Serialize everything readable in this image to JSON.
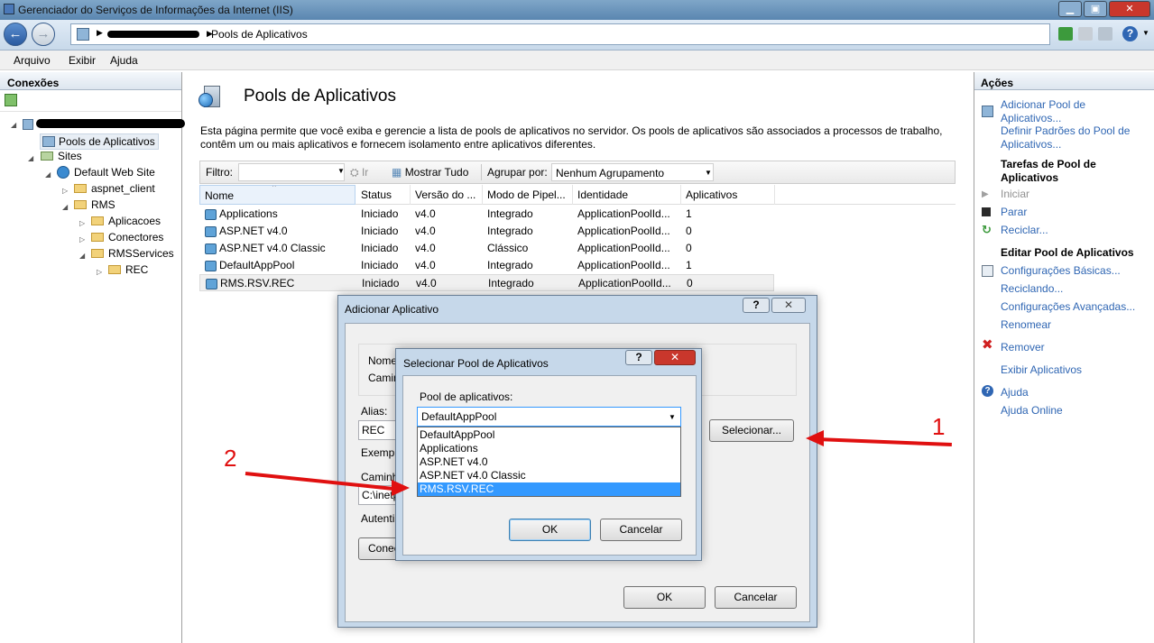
{
  "window": {
    "title": "Gerenciador do Serviços de Informações da Internet (IIS)"
  },
  "address": {
    "current": "Pools de Aplicativos"
  },
  "menu": {
    "file": "Arquivo",
    "view": "Exibir",
    "help": "Ajuda"
  },
  "connections": {
    "header": "Conexões",
    "items": [
      "Pools de Aplicativos",
      "Sites",
      "Default Web Site",
      "aspnet_client",
      "RMS",
      "Aplicacoes",
      "Conectores",
      "RMSServices",
      "REC"
    ]
  },
  "main": {
    "title": "Pools de Aplicativos",
    "description": "Esta página permite que você exiba e gerencie a lista de pools de aplicativos no servidor. Os pools de aplicativos são associados a processos de trabalho, contêm um ou mais aplicativos e fornecem isolamento entre aplicativos diferentes.",
    "filter_label": "Filtro:",
    "go_label": "Ir",
    "show_all": "Mostrar Tudo",
    "group_by_label": "Agrupar por:",
    "group_by_value": "Nenhum Agrupamento",
    "columns": [
      "Nome",
      "Status",
      "Versão do ...",
      "Modo de Pipel...",
      "Identidade",
      "Aplicativos"
    ],
    "rows": [
      [
        "Applications",
        "Iniciado",
        "v4.0",
        "Integrado",
        "ApplicationPoolId...",
        "1"
      ],
      [
        "ASP.NET v4.0",
        "Iniciado",
        "v4.0",
        "Integrado",
        "ApplicationPoolId...",
        "0"
      ],
      [
        "ASP.NET v4.0 Classic",
        "Iniciado",
        "v4.0",
        "Clássico",
        "ApplicationPoolId...",
        "0"
      ],
      [
        "DefaultAppPool",
        "Iniciado",
        "v4.0",
        "Integrado",
        "ApplicationPoolId...",
        "1"
      ],
      [
        "RMS.RSV.REC",
        "Iniciado",
        "v4.0",
        "Integrado",
        "ApplicationPoolId...",
        "0"
      ]
    ]
  },
  "actions": {
    "header": "Ações",
    "add_pool": "Adicionar Pool de Aplicativos...",
    "set_defaults": "Definir Padrões do Pool de Aplicativos...",
    "tasks_header": "Tarefas de Pool de Aplicativos",
    "start": "Iniciar",
    "stop": "Parar",
    "recycle": "Reciclar...",
    "edit_header": "Editar Pool de Aplicativos",
    "basic": "Configurações Básicas...",
    "recycling": "Reciclando...",
    "advanced": "Configurações Avançadas...",
    "rename": "Renomear",
    "remove": "Remover",
    "view_apps": "Exibir Aplicativos",
    "help": "Ajuda",
    "help_online": "Ajuda Online"
  },
  "add_app_dialog": {
    "title": "Adicionar Aplicativo",
    "site_label": "Nome",
    "path_label": "Camin",
    "alias_label": "Alias:",
    "alias_value": "REC",
    "example_label": "Exempl",
    "physical_label": "Caminh",
    "physical_value": "C:\\inetp",
    "auth_label": "Autenti",
    "connect_button": "Conec",
    "select_button": "Selecionar...",
    "ok": "OK",
    "cancel": "Cancelar",
    "help_glyph": "?",
    "close_glyph": "✕"
  },
  "select_pool_dialog": {
    "title": "Selecionar Pool de Aplicativos",
    "pool_label": "Pool de aplicativos:",
    "selected": "DefaultAppPool",
    "options": [
      "DefaultAppPool",
      "Applications",
      "ASP.NET v4.0",
      "ASP.NET v4.0 Classic",
      "RMS.RSV.REC"
    ],
    "ok": "OK",
    "cancel": "Cancelar",
    "help_glyph": "?",
    "close_glyph": "✕"
  },
  "annotations": {
    "one": "1",
    "two": "2"
  },
  "colors": {
    "link": "#2f66b3",
    "arrow": "#e01010",
    "selection": "#3399ff",
    "close_red": "#c9372c"
  }
}
